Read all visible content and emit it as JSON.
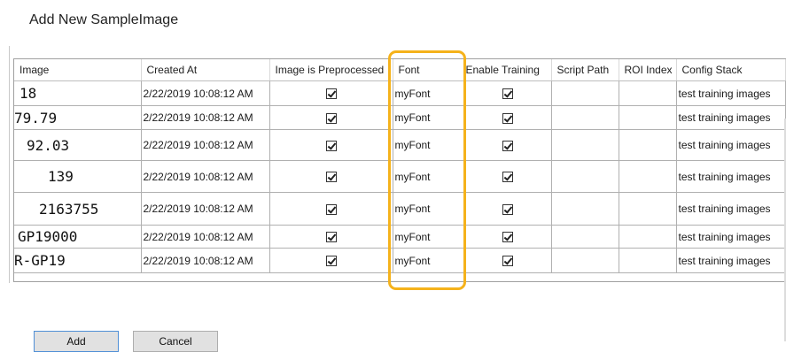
{
  "window": {
    "title": "Add New SampleImage"
  },
  "grid": {
    "columns": [
      "Image",
      "Created At",
      "Image is Preprocessed",
      "Font",
      "Enable Training",
      "Script Path",
      "ROI Index",
      "Config Stack"
    ],
    "rows": [
      {
        "image": "18",
        "created_at": "2/22/2019 10:08:12 AM",
        "preprocessed": true,
        "font": "myFont",
        "enable_training": true,
        "script_path": "",
        "roi_index": "",
        "config_stack": "test training images"
      },
      {
        "image": "79.79",
        "created_at": "2/22/2019 10:08:12 AM",
        "preprocessed": true,
        "font": "myFont",
        "enable_training": true,
        "script_path": "",
        "roi_index": "",
        "config_stack": "test training images"
      },
      {
        "image": "92.03",
        "created_at": "2/22/2019 10:08:12 AM",
        "preprocessed": true,
        "font": "myFont",
        "enable_training": true,
        "script_path": "",
        "roi_index": "",
        "config_stack": "test training images"
      },
      {
        "image": "139",
        "created_at": "2/22/2019 10:08:12 AM",
        "preprocessed": true,
        "font": "myFont",
        "enable_training": true,
        "script_path": "",
        "roi_index": "",
        "config_stack": "test training images"
      },
      {
        "image": "2163755",
        "created_at": "2/22/2019 10:08:12 AM",
        "preprocessed": true,
        "font": "myFont",
        "enable_training": true,
        "script_path": "",
        "roi_index": "",
        "config_stack": "test training images"
      },
      {
        "image": "GP19000",
        "created_at": "2/22/2019 10:08:12 AM",
        "preprocessed": true,
        "font": "myFont",
        "enable_training": true,
        "script_path": "",
        "roi_index": "",
        "config_stack": "test training images"
      },
      {
        "image": "R-GP19",
        "created_at": "2/22/2019 10:08:12 AM",
        "preprocessed": true,
        "font": "myFont",
        "enable_training": true,
        "script_path": "",
        "roi_index": "",
        "config_stack": "test training images"
      }
    ]
  },
  "buttons": {
    "add": "Add",
    "cancel": "Cancel"
  },
  "colors": {
    "highlight": "#f5b21b",
    "default_button_border": "#4f8fd6",
    "button_bg": "#e1e1e1"
  }
}
